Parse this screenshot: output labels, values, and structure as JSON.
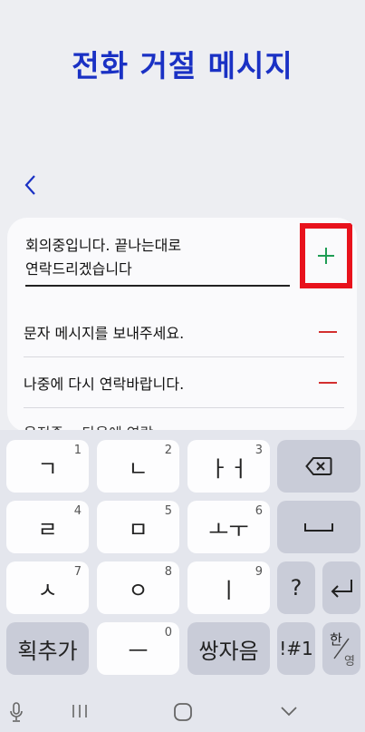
{
  "header": {
    "title": "전화 거절 메시지"
  },
  "input": {
    "line1": "회의중입니다. 끝나는대로",
    "line2": "연락드리겠습니다"
  },
  "messages": [
    {
      "text": "문자 메시지를 보내주세요."
    },
    {
      "text": "나중에 다시 연락바랍니다."
    }
  ],
  "partial_message": "운전중... 다음에 연락...",
  "keyboard": {
    "row1": [
      {
        "label": "ㄱ",
        "hint": "1"
      },
      {
        "label": "ㄴ",
        "hint": "2"
      },
      {
        "label": "ㅏㅓ",
        "hint": "3"
      }
    ],
    "row2": [
      {
        "label": "ㄹ",
        "hint": "4"
      },
      {
        "label": "ㅁ",
        "hint": "5"
      },
      {
        "label": "ㅗㅜ",
        "hint": "6"
      }
    ],
    "row3": [
      {
        "label": "ㅅ",
        "hint": "7"
      },
      {
        "label": "ㅇ",
        "hint": "8"
      },
      {
        "label": "ㅣ",
        "hint": "9"
      }
    ],
    "row4": [
      {
        "label": "획추가"
      },
      {
        "label": "ㅡ",
        "hint": "0"
      },
      {
        "label": "쌍자음"
      }
    ],
    "question": "?",
    "symbols": "!#1",
    "lang_top": "한",
    "lang_bottom": "영"
  },
  "colors": {
    "title": "#1a31c4",
    "plus": "#1f9d55",
    "minus": "#d32f2f",
    "highlight": "#e8121c"
  }
}
